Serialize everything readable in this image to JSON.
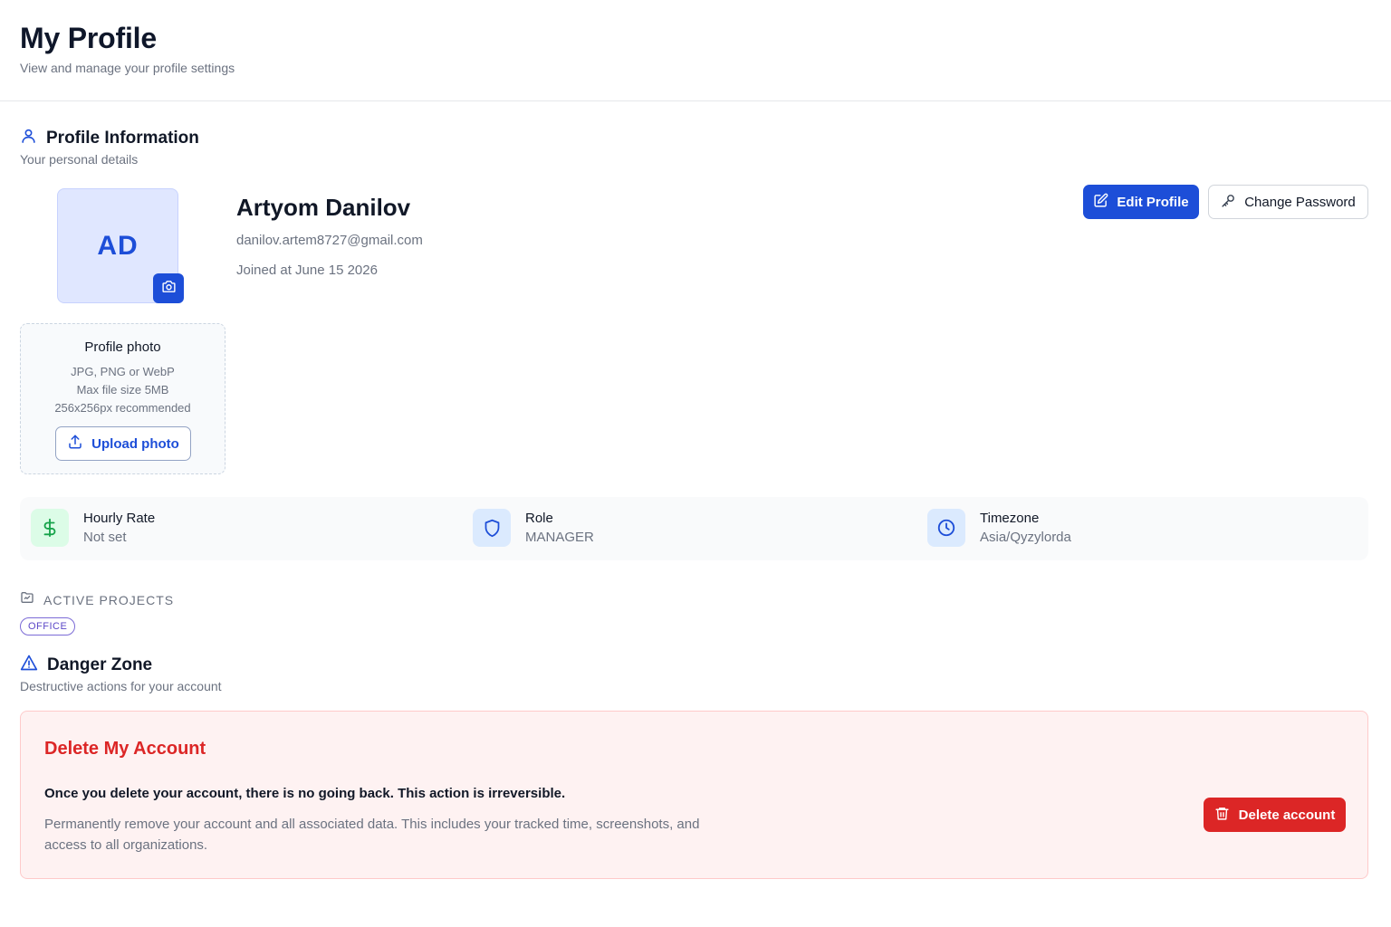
{
  "header": {
    "title": "My Profile",
    "subtitle": "View and manage your profile settings"
  },
  "profile_section": {
    "title": "Profile Information",
    "subtitle": "Your personal details",
    "icon": "user-icon"
  },
  "user": {
    "initials": "AD",
    "name": "Artyom Danilov",
    "email": "danilov.artem8727@gmail.com",
    "joined": "Joined at June 15 2026"
  },
  "actions": {
    "edit_label": "Edit Profile",
    "change_password_label": "Change Password"
  },
  "upload": {
    "title": "Profile photo",
    "formats": "JPG, PNG or WebP",
    "max_size": "Max file size 5MB",
    "recommended": "256x256px recommended",
    "button_label": "Upload photo"
  },
  "stats": [
    {
      "label": "Hourly Rate",
      "value": "Not set",
      "icon": "dollar-icon"
    },
    {
      "label": "Role",
      "value": "MANAGER",
      "icon": "shield-icon"
    },
    {
      "label": "Timezone",
      "value": "Asia/Qyzylorda",
      "icon": "clock-icon"
    }
  ],
  "projects": {
    "title": "ACTIVE PROJECTS",
    "items": [
      "OFFICE"
    ]
  },
  "danger_zone": {
    "title": "Danger Zone",
    "subtitle": "Destructive actions for your account",
    "card_title": "Delete My Account",
    "warning": "Once you delete your account, there is no going back. This action is irreversible.",
    "description": "Permanently remove your account and all associated data. This includes your tracked time, screenshots, and access to all organizations.",
    "button_label": "Delete account"
  },
  "colors": {
    "primary": "#1d4ed8",
    "danger": "#dc2626",
    "danger_bg": "#fef2f2",
    "muted_text": "#6b7280"
  }
}
